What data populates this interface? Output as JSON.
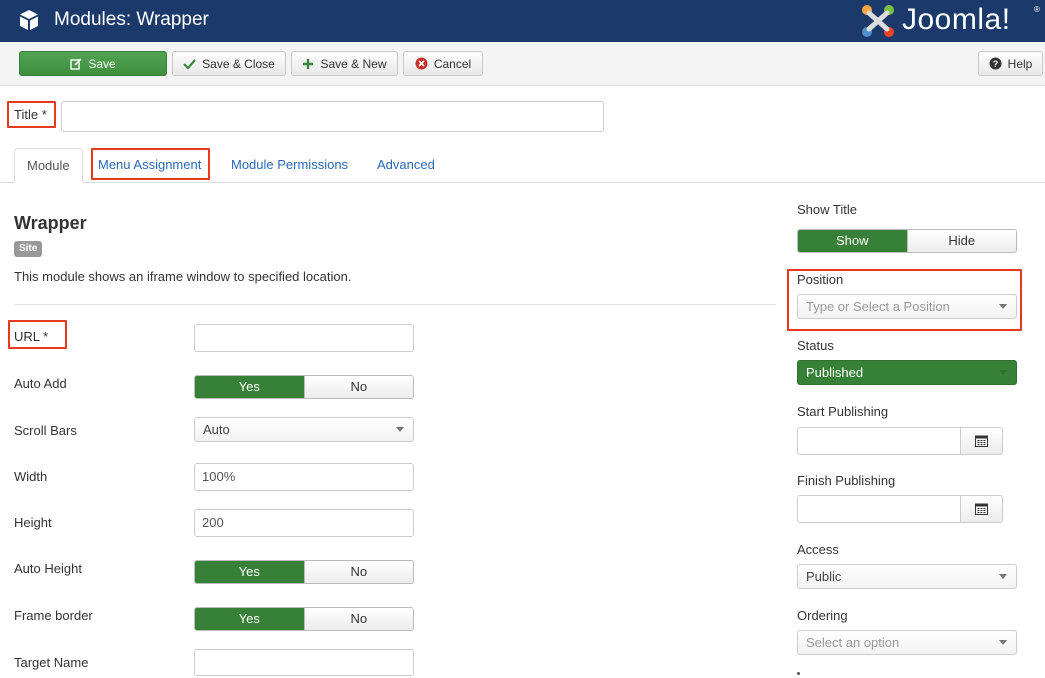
{
  "header": {
    "title": "Modules: Wrapper",
    "logo_text": "Joomla!",
    "logo_reg": "®"
  },
  "toolbar": {
    "save_label": "Save",
    "save_close_label": "Save & Close",
    "save_new_label": "Save & New",
    "cancel_label": "Cancel",
    "help_label": "Help"
  },
  "title_field": {
    "label": "Title *",
    "value": ""
  },
  "tabs": [
    {
      "label": "Module",
      "active": true
    },
    {
      "label": "Menu Assignment",
      "active": false
    },
    {
      "label": "Module Permissions",
      "active": false
    },
    {
      "label": "Advanced",
      "active": false
    }
  ],
  "module": {
    "heading": "Wrapper",
    "badge": "Site",
    "description": "This module shows an iframe window to specified location."
  },
  "fields": {
    "url": {
      "label": "URL *",
      "value": ""
    },
    "auto_add": {
      "label": "Auto Add",
      "yes": "Yes",
      "no": "No",
      "selected": "Yes"
    },
    "scroll_bars": {
      "label": "Scroll Bars",
      "value": "Auto"
    },
    "width": {
      "label": "Width",
      "value": "100%"
    },
    "height": {
      "label": "Height",
      "value": "200"
    },
    "auto_height": {
      "label": "Auto Height",
      "yes": "Yes",
      "no": "No",
      "selected": "Yes"
    },
    "frame_border": {
      "label": "Frame border",
      "yes": "Yes",
      "no": "No",
      "selected": "Yes"
    },
    "target_name": {
      "label": "Target Name",
      "value": ""
    }
  },
  "sidebar": {
    "show_title": {
      "label": "Show Title",
      "show": "Show",
      "hide": "Hide",
      "selected": "Show"
    },
    "position": {
      "label": "Position",
      "placeholder": "Type or Select a Position"
    },
    "status": {
      "label": "Status",
      "value": "Published"
    },
    "start_publishing": {
      "label": "Start Publishing",
      "value": ""
    },
    "finish_publishing": {
      "label": "Finish Publishing",
      "value": ""
    },
    "access": {
      "label": "Access",
      "value": "Public"
    },
    "ordering": {
      "label": "Ordering",
      "placeholder": "Select an option"
    }
  },
  "colors": {
    "header_bg": "#1b3a6b",
    "success": "#378037",
    "highlight": "#e63a1e",
    "link": "#2a69b8"
  }
}
